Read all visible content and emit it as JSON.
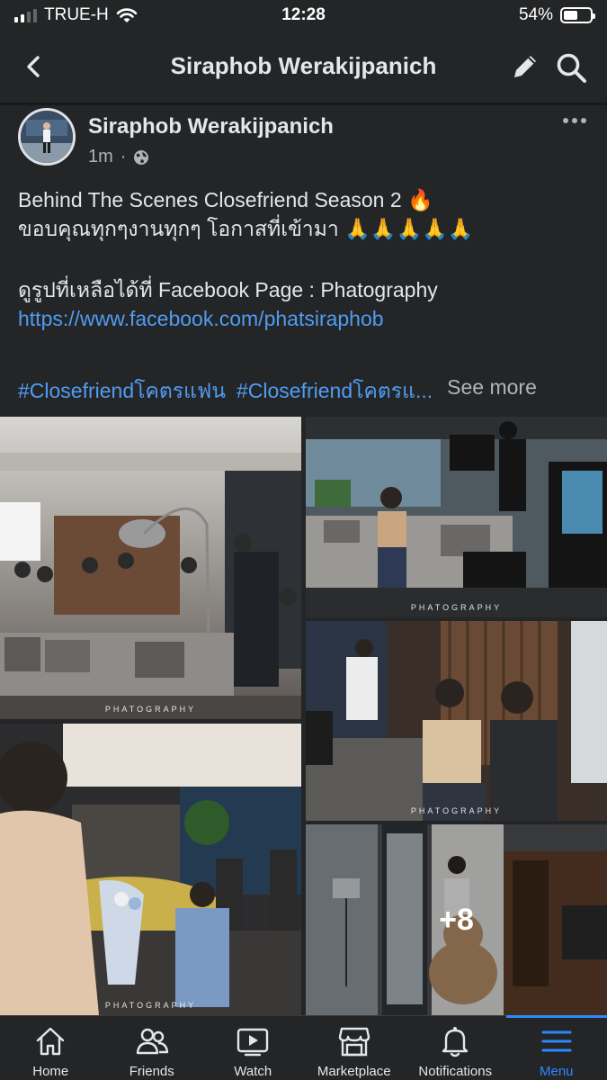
{
  "status_bar": {
    "carrier": "TRUE-H",
    "time": "12:28",
    "battery": "54%",
    "battery_level": 0.54
  },
  "header": {
    "title": "Siraphob Werakijpanich",
    "back_icon": "chevron-left-icon",
    "edit_icon": "pencil-icon",
    "search_icon": "search-icon"
  },
  "post": {
    "author": "Siraphob Werakijpanich",
    "time": "1m",
    "separator": "·",
    "audience_icon": "globe-icon",
    "lines": [
      "Behind The Scenes Closefriend Season 2 🔥",
      "ขอบคุณทุกๆงานทุกๆ โอกาสที่เข้ามา 🙏🙏🙏🙏🙏"
    ],
    "more_line": "ดูรูปที่เหลือได้ที่ Facebook Page : Phatography",
    "link": "https://www.facebook.com/phatsiraphob",
    "hashtags": [
      "#Closefriendโคตรแฟน",
      "#Closefriendโคตรแ..."
    ],
    "see_more": "See more",
    "photos": {
      "watermark": "PHATOGRAPHY",
      "more_count": "+8"
    }
  },
  "tabs": [
    {
      "label": "Home",
      "icon": "home-icon"
    },
    {
      "label": "Friends",
      "icon": "friends-icon"
    },
    {
      "label": "Watch",
      "icon": "watch-icon"
    },
    {
      "label": "Marketplace",
      "icon": "marketplace-icon"
    },
    {
      "label": "Notifications",
      "icon": "bell-icon"
    },
    {
      "label": "Menu",
      "icon": "menu-icon",
      "active": true
    }
  ],
  "colors": {
    "background": "#242526",
    "link": "#4f9cf3",
    "active_tab": "#2d88ff",
    "text": "#e4e6eb",
    "muted": "#b0b3b8"
  }
}
